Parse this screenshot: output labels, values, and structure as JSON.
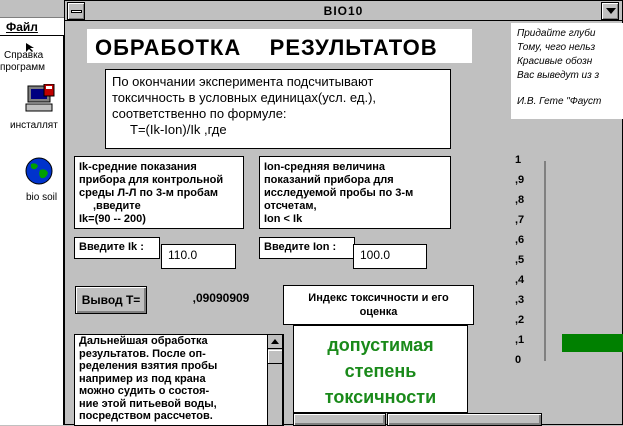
{
  "desktop": {
    "menu_label": "Файл",
    "icons": [
      {
        "label_line1": "Справка",
        "label_line2": "программ",
        "icon": "help-pointer-icon"
      },
      {
        "label_line1": "инсталлят",
        "label_line2": "",
        "icon": "installer-computer-icon"
      },
      {
        "label_line1": "bio soil",
        "label_line2": "",
        "icon": "globe-icon"
      }
    ]
  },
  "window": {
    "title": "BIO10",
    "heading": "ОБРАБОТКА    РЕЗУЛЬТАТОВ",
    "quote": {
      "lines": [
        "Придайте глуби",
        "Тому, чего нельз",
        "Красивые обозн",
        "Вас выведут из з"
      ],
      "author": "И.В. Гете \"Фауст"
    },
    "formula_box": {
      "line1": "По окончании эксперимента подсчитывают",
      "line2": "токсичность в условных единицах(усл. ед.),",
      "line3": "соответственно по формуле:",
      "line4": "T=(Ik-Ion)/Ik    ,где"
    },
    "ik_box": {
      "line1": "Ik-средние показания",
      "line2": "прибора для контрольной",
      "line3": "среды Л-Л по 3-м пробам",
      "line4": ",введите",
      "line5": "Ik=(90    --    200)"
    },
    "ion_box": {
      "line1": "Ion-средняя величина",
      "line2": "показаний прибора для",
      "line3": "исследуемой пробы по 3-м",
      "line4": "отсчетам,",
      "line5": " Ion < Ik"
    },
    "ik_input": {
      "label": "Введите Ik  :",
      "value": "110.0"
    },
    "ion_input": {
      "label": "Введите  Ion  :",
      "value": "100.0"
    },
    "output_button": "Вывод  T=",
    "output_value": ",09090909",
    "index_box": {
      "line1": "Индекс токсичности и его",
      "line2": "оценка"
    },
    "rating": {
      "line1": "допустимая",
      "line2": "степень",
      "line3": "токсичности"
    },
    "further": {
      "lines": [
        "   Дальнейшая   обработка",
        "результатов.  После  оп-",
        "ределения взятия  пробы",
        "например из  под  крана",
        "можно судить о состоя-",
        "ние этой питьевой воды,",
        "посредством     рассчетов."
      ]
    },
    "gauge": {
      "ticks": [
        "1",
        ",9",
        ",8",
        ",7",
        ",6",
        ",5",
        ",4",
        ",3",
        ",2",
        ",1",
        "0"
      ],
      "level": 0.0909,
      "fill_color": "#008000"
    }
  }
}
